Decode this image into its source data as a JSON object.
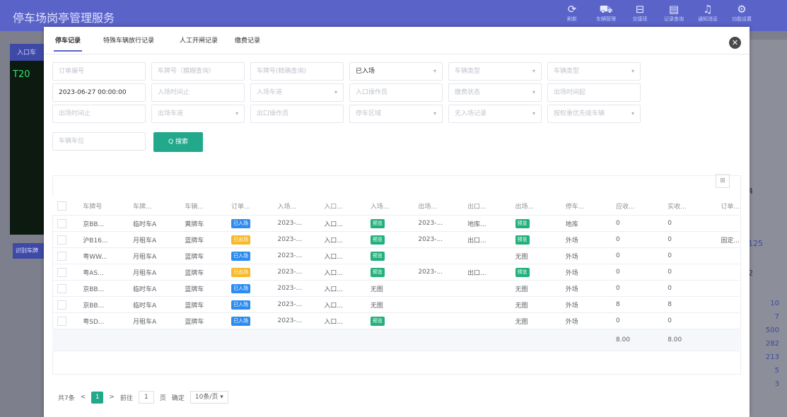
{
  "app_title": "停车场岗亭管理服务",
  "top_nav": [
    {
      "icon": "refresh-icon",
      "glyph": "⟳",
      "label": "刷新"
    },
    {
      "icon": "car-icon",
      "glyph": "⛟",
      "label": "车辆管理"
    },
    {
      "icon": "vehicle-icon",
      "glyph": "⊟",
      "label": "交接班"
    },
    {
      "icon": "record-icon",
      "glyph": "▤",
      "label": "记录查询"
    },
    {
      "icon": "bell-icon",
      "glyph": "♫",
      "label": "通知消息"
    },
    {
      "icon": "settings-icon",
      "glyph": "⚙",
      "label": "功能设置"
    }
  ],
  "background": {
    "tab_label": "入口车",
    "plate_partial": "T20",
    "left_button": "识别车牌",
    "right_top_value": "4",
    "right_value_blue": "125",
    "right_value_2": "2",
    "right_stats": [
      "10",
      "7",
      "500",
      "282",
      "213",
      "5",
      "3"
    ]
  },
  "modal": {
    "close_glyph": "✕",
    "tabs": [
      "停车记录",
      "特殊车辆放行记录",
      "人工开闸记录",
      "缴费记录"
    ],
    "filters": [
      {
        "placeholder": "订单编号",
        "value": ""
      },
      {
        "placeholder": "车牌号（模糊查询）",
        "value": ""
      },
      {
        "placeholder": "车牌号(精确查询)",
        "value": ""
      },
      {
        "placeholder": "",
        "value": "已入场",
        "select": true
      },
      {
        "placeholder": "车辆类型",
        "value": "",
        "select": true
      },
      {
        "placeholder": "车辆类型",
        "value": "",
        "select": true
      },
      {
        "placeholder": "",
        "value": "2023-06-27 00:00:00"
      },
      {
        "placeholder": "入场时间止",
        "value": ""
      },
      {
        "placeholder": "入场车道",
        "value": "",
        "select": true
      },
      {
        "placeholder": "入口操作员",
        "value": ""
      },
      {
        "placeholder": "缴费状态",
        "value": "",
        "select": true
      },
      {
        "placeholder": "出场时间起",
        "value": ""
      },
      {
        "placeholder": "出场时间止",
        "value": ""
      },
      {
        "placeholder": "出场车道",
        "value": "",
        "select": true
      },
      {
        "placeholder": "出口操作员",
        "value": ""
      },
      {
        "placeholder": "停车区域",
        "value": "",
        "select": true
      },
      {
        "placeholder": "无入场记录",
        "value": "",
        "select": true
      },
      {
        "placeholder": "按权重优先级车辆",
        "value": "",
        "select": true
      },
      {
        "placeholder": "车辆车位",
        "value": ""
      }
    ],
    "search_button": "Q 搜索",
    "tool_glyph": "⊞",
    "columns": [
      "车牌号",
      "车牌...",
      "车辆...",
      "订单...",
      "入场...",
      "入口...",
      "入场...",
      "出场...",
      "出口...",
      "出场...",
      "停车...",
      "应收...",
      "实收...",
      "订单..."
    ],
    "rows": [
      [
        "京BB...",
        "临时车A",
        "黄牌车",
        "已入场",
        "2023-...",
        "入口...",
        "预览",
        "2023-...",
        "地库...",
        "预览",
        "地库",
        "0",
        "0",
        ""
      ],
      [
        "沪B16...",
        "月租车A",
        "蓝牌车",
        "已出场",
        "2023-...",
        "入口...",
        "预览",
        "2023-...",
        "出口...",
        "预览",
        "外场",
        "0",
        "0",
        "固定..."
      ],
      [
        "粤WW...",
        "月租车A",
        "蓝牌车",
        "已入场",
        "2023-...",
        "入口...",
        "预览",
        "",
        "",
        "无图",
        "外场",
        "0",
        "0",
        ""
      ],
      [
        "粤AS...",
        "月租车A",
        "蓝牌车",
        "已出场",
        "2023-...",
        "入口...",
        "预览",
        "2023-...",
        "出口...",
        "预览",
        "外场",
        "0",
        "0",
        ""
      ],
      [
        "京BB...",
        "临时车A",
        "蓝牌车",
        "已入场",
        "2023-...",
        "入口...",
        "无图",
        "",
        "",
        "无图",
        "外场",
        "0",
        "0",
        ""
      ],
      [
        "京BB...",
        "临时车A",
        "蓝牌车",
        "已入场",
        "2023-...",
        "入口...",
        "无图",
        "",
        "",
        "无图",
        "外场",
        "8",
        "8",
        ""
      ],
      [
        "粤SD...",
        "月租车A",
        "蓝牌车",
        "已入场",
        "2023-...",
        "入口...",
        "预览",
        "",
        "",
        "无图",
        "外场",
        "0",
        "0",
        ""
      ]
    ],
    "summary": {
      "receivable": "8.00",
      "received": "8.00"
    },
    "pager": {
      "total": "共7条",
      "prev": "<",
      "current": "1",
      "next": ">",
      "goto": "前往",
      "page_input": "1",
      "page_unit": "页",
      "confirm": "确定",
      "page_size": "10条/页 ▾"
    }
  }
}
